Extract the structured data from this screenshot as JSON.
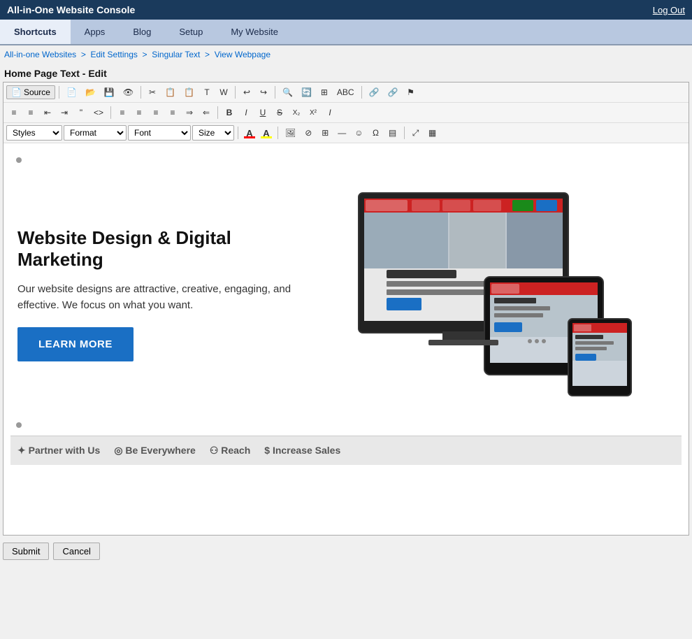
{
  "header": {
    "title": "All-in-One Website Console",
    "logout_label": "Log Out"
  },
  "nav": {
    "items": [
      {
        "label": "Shortcuts",
        "active": true
      },
      {
        "label": "Apps",
        "active": false
      },
      {
        "label": "Blog",
        "active": false
      },
      {
        "label": "Setup",
        "active": false
      },
      {
        "label": "My Website",
        "active": false
      }
    ]
  },
  "breadcrumb": {
    "parts": [
      {
        "label": "All-in-one Websites",
        "link": true
      },
      {
        "label": "Edit Settings",
        "link": true
      },
      {
        "label": "Singular Text",
        "link": true
      },
      {
        "label": "View Webpage",
        "link": true
      }
    ],
    "separator": ">"
  },
  "page": {
    "title": "Home Page Text - Edit"
  },
  "toolbar": {
    "row1": {
      "source_label": "Source",
      "buttons": [
        "new-doc",
        "open",
        "save",
        "save-as",
        "cut",
        "copy",
        "paste",
        "paste-text",
        "paste-word",
        "undo",
        "redo",
        "find",
        "replace",
        "select-all",
        "spell-check",
        "link",
        "unlink",
        "anchor"
      ]
    },
    "row2": {
      "buttons": [
        "ordered-list",
        "unordered-list",
        "decrease-indent",
        "increase-indent",
        "blockquote",
        "div",
        "align-left",
        "align-center",
        "align-right",
        "align-justify",
        "ltr",
        "rtl",
        "bold",
        "italic",
        "underline",
        "strike",
        "subscript",
        "superscript",
        "remove-format"
      ]
    },
    "row3": {
      "styles_label": "Styles",
      "format_label": "Format",
      "font_label": "Font",
      "size_label": "Size",
      "color_label": "A",
      "bgcolor_label": "A",
      "image_label": "img",
      "table_label": "table",
      "hr_label": "hr",
      "emoji_label": "☺",
      "special_char_label": "Ω",
      "maximize_label": "⤢",
      "show_blocks_label": "▤"
    }
  },
  "content": {
    "heading": "Website Design & Digital Marketing",
    "body": "Our website designs are attractive, creative, engaging, and effective. We focus on what you want.",
    "cta_label": "LEARN MORE",
    "bottom_items": [
      "✦ Partner with Us",
      "◎ Be Everywhere",
      "⚇ Reach",
      "$ Increase Sales"
    ]
  },
  "form": {
    "submit_label": "Submit",
    "cancel_label": "Cancel"
  }
}
